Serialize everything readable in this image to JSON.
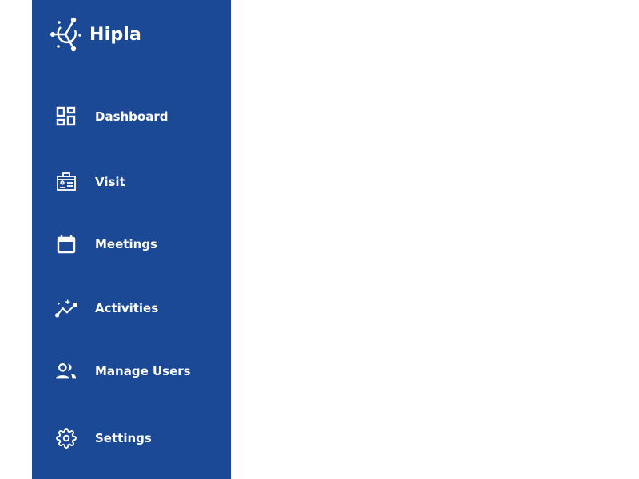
{
  "brand": {
    "name": "Hipla",
    "color": "#1c4996"
  },
  "sidebar": {
    "items": [
      {
        "label": "Dashboard",
        "icon": "dashboard-icon"
      },
      {
        "label": "Visit",
        "icon": "visitor-badge-icon"
      },
      {
        "label": "Meetings",
        "icon": "calendar-icon"
      },
      {
        "label": "Activities",
        "icon": "activity-chart-icon"
      },
      {
        "label": "Manage Users",
        "icon": "users-icon"
      },
      {
        "label": "Settings",
        "icon": "gear-icon"
      }
    ]
  }
}
